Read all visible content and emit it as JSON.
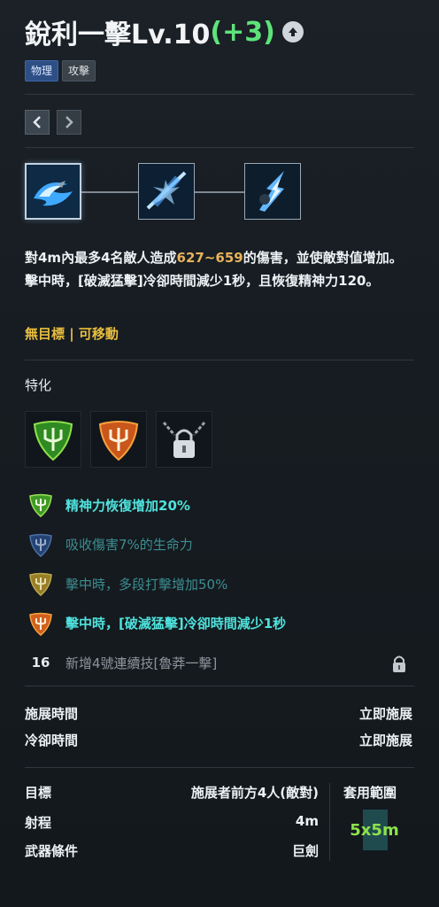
{
  "skill": {
    "name": "銳利一擊Lv.10",
    "bonus": "(+3)",
    "tags": [
      "物理",
      "攻擊"
    ]
  },
  "icons": {
    "upgrade": "arrow-up-circle-icon",
    "prev": "chevron-left-icon",
    "next": "chevron-right-icon"
  },
  "description": {
    "part1": "對4m內最多4名敵人造成",
    "damage": "627~659",
    "part2": "的傷害，並使敵對值增加。擊中時，[破滅猛擊]冷卻時間減少1秒，且恢復精神力120。"
  },
  "attributes": "無目標 | 可移動",
  "specialization": {
    "title": "特化",
    "icons": [
      "green-trident-shield-icon",
      "orange-trident-shield-icon",
      "padlock-chain-icon"
    ],
    "effects": [
      {
        "label": "精神力恢復增加20%",
        "color": "#6cc23a",
        "state": "active"
      },
      {
        "label": "吸收傷害7%的生命力",
        "color": "#3a6fc2",
        "state": "dim"
      },
      {
        "label": "擊中時，多段打擊增加50%",
        "color": "#d9b52a",
        "state": "dim"
      },
      {
        "label": "擊中時，[破滅猛擊]冷卻時間減少1秒",
        "color": "#e06a1c",
        "state": "active"
      }
    ],
    "locked": {
      "level": "16",
      "label": "新增4號連續技[魯莽一擊]"
    }
  },
  "timing": {
    "cast_label": "施展時間",
    "cast_value": "立即施展",
    "cooldown_label": "冷卻時間",
    "cooldown_value": "立即施展"
  },
  "targeting": {
    "target_label": "目標",
    "target_value": "施展者前方4人(敵對)",
    "range_label": "射程",
    "range_value": "4m",
    "weapon_label": "武器條件",
    "weapon_value": "巨劍",
    "area_label": "套用範圍",
    "area_value": "5x5m"
  },
  "colors": {
    "bonus": "#5ee37a",
    "damage": "#e8b35a",
    "attributes": "#e9bf3f",
    "effect_active": "#4fe2dd",
    "effect_dim": "#3c8e92",
    "area": "#8de24b"
  }
}
